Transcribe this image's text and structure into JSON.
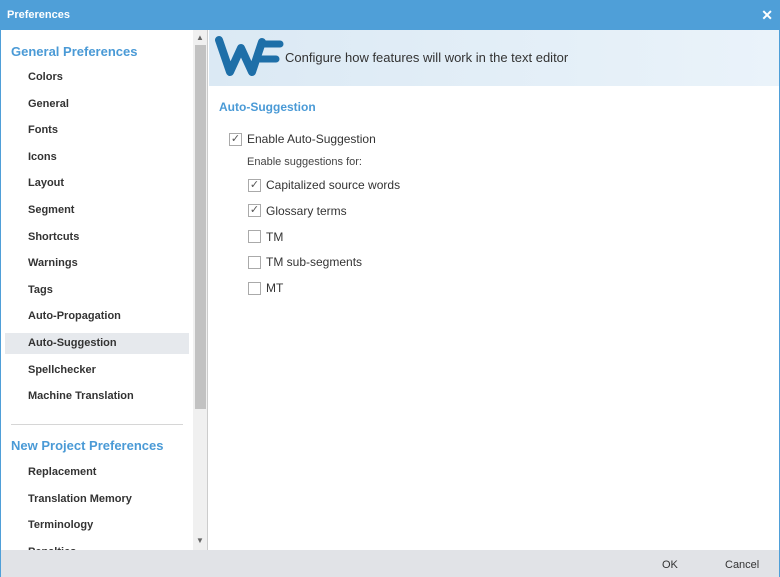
{
  "window": {
    "title": "Preferences"
  },
  "sidebar": {
    "general_title": "General Preferences",
    "general_items": [
      "Colors",
      "General",
      "Fonts",
      "Icons",
      "Layout",
      "Segment",
      "Shortcuts",
      "Warnings",
      "Tags",
      "Auto-Propagation",
      "Auto-Suggestion",
      "Spellchecker",
      "Machine Translation"
    ],
    "selected": "Auto-Suggestion",
    "project_title": "New Project Preferences",
    "project_items": [
      "Replacement",
      "Translation Memory",
      "Terminology",
      "Penalties"
    ]
  },
  "banner": {
    "logo": "WF",
    "text": "Configure how features will work in the text editor"
  },
  "main": {
    "heading": "Auto-Suggestion",
    "enable": {
      "label": "Enable Auto-Suggestion",
      "checked": true
    },
    "sub_label": "Enable suggestions for:",
    "options": [
      {
        "label": "Capitalized source words",
        "checked": true
      },
      {
        "label": "Glossary terms",
        "checked": true
      },
      {
        "label": "TM",
        "checked": false
      },
      {
        "label": "TM sub-segments",
        "checked": false
      },
      {
        "label": "MT",
        "checked": false
      }
    ]
  },
  "footer": {
    "ok": "OK",
    "cancel": "Cancel"
  },
  "colors": {
    "accent": "#4f9fd8",
    "logo": "#1e6fa8"
  }
}
